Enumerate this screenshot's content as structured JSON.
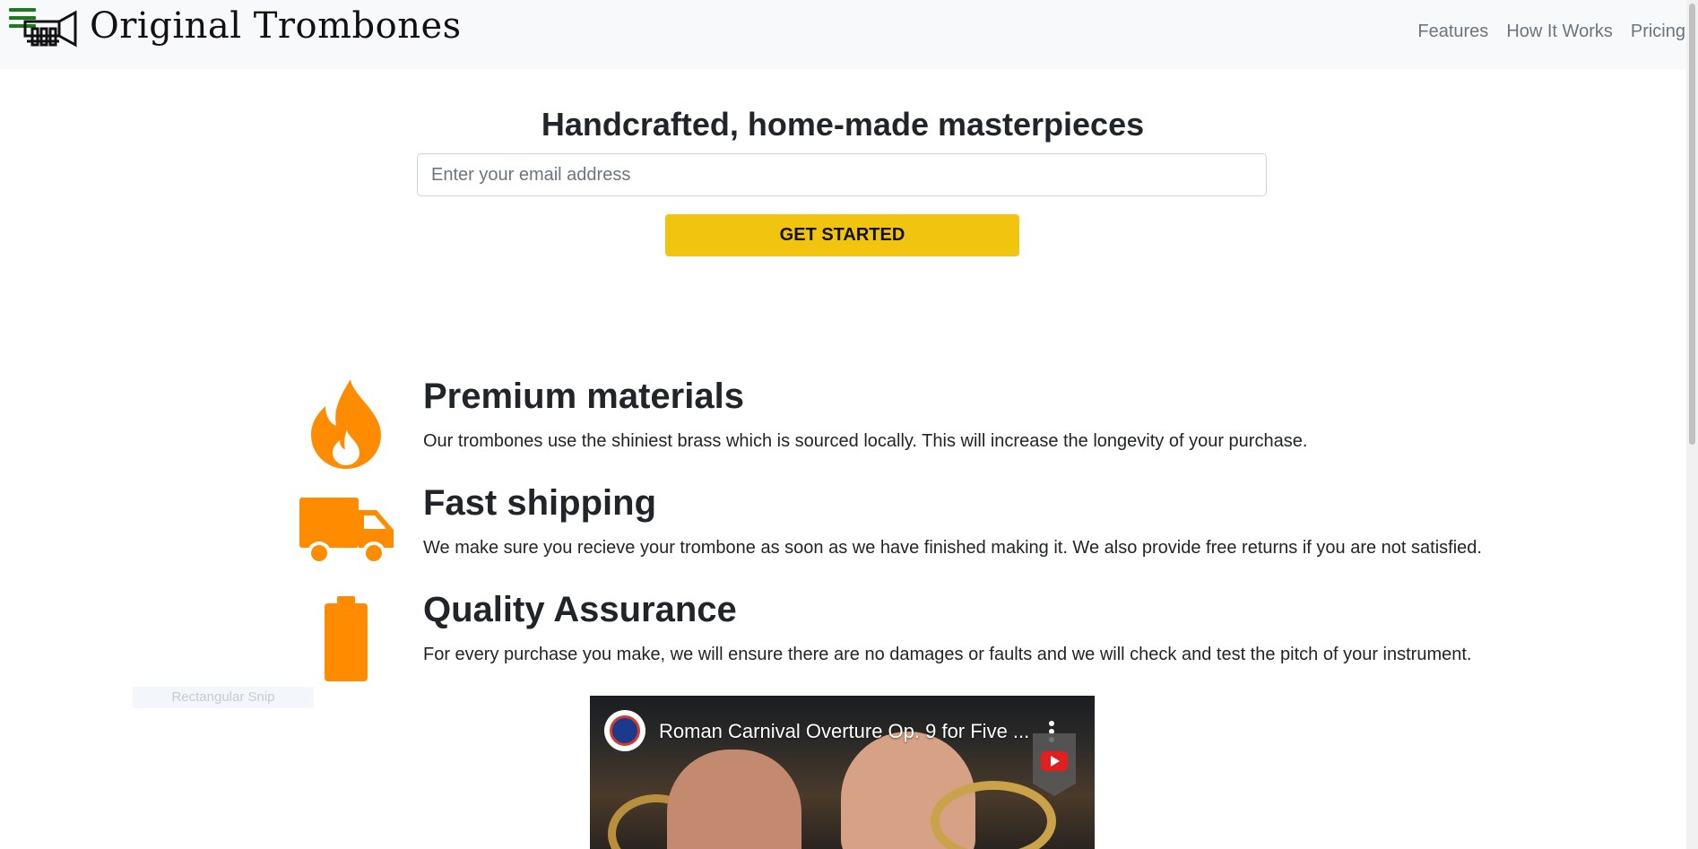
{
  "header": {
    "brand": "Original Trombones",
    "nav": [
      {
        "label": "Features"
      },
      {
        "label": "How It Works"
      },
      {
        "label": "Pricing"
      }
    ]
  },
  "hero": {
    "title": "Handcrafted, home-made masterpieces",
    "email_placeholder": "Enter your email address",
    "cta_label": "GET STARTED"
  },
  "features": [
    {
      "icon": "fire-icon",
      "title": "Premium materials",
      "text": "Our trombones use the shiniest brass which is sourced locally. This will increase the longevity of your purchase."
    },
    {
      "icon": "truck-icon",
      "title": "Fast shipping",
      "text": "We make sure you recieve your trombone as soon as we have finished making it. We also provide free returns if you are not satisfied."
    },
    {
      "icon": "battery-icon",
      "title": "Quality Assurance",
      "text": "For every purchase you make, we will ensure there are no damages or faults and we will check and test the pitch of your instrument."
    }
  ],
  "overlay": {
    "snip_label": "Rectangular Snip"
  },
  "video": {
    "title": "Roman Carnival Overture Op. 9 for Five ..."
  },
  "colors": {
    "accent": "#f1c40f",
    "icon": "#ff8c00",
    "nav_bg": "#f8f9fa",
    "hamburger": "#1f7a1f"
  }
}
